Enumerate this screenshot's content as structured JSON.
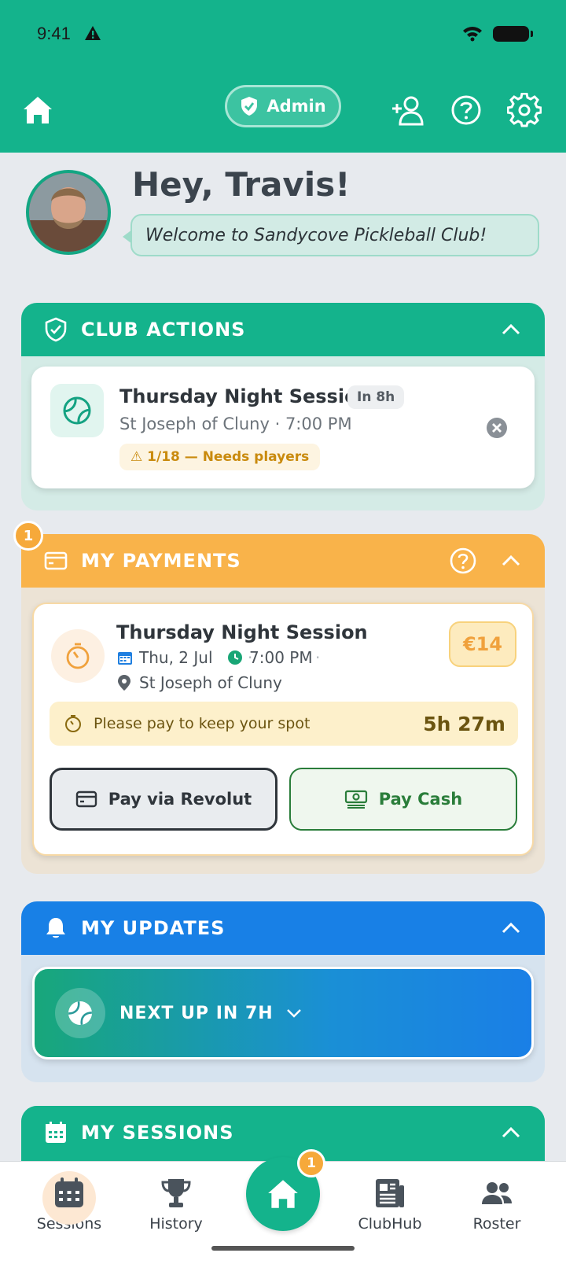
{
  "status": {
    "time": "9:41"
  },
  "header": {
    "admin_label": "Admin"
  },
  "greeting": {
    "title": "Hey, Travis!",
    "welcome": "Welcome to Sandycove Pickleball Club!"
  },
  "club_actions": {
    "title": "CLUB ACTIONS",
    "session_title": "Thursday Night Session",
    "badge": "In 8h",
    "subtitle": "St Joseph of Cluny · 7:00 PM",
    "warning": "⚠ 1/18 — Needs players"
  },
  "payments": {
    "title": "MY PAYMENTS",
    "badge_count": "1",
    "session_title": "Thursday Night Session",
    "date": "Thu, 2 Jul",
    "time": "7:00 PM",
    "venue": "St Joseph of Cluny",
    "price": "€14",
    "notice": "Please pay to keep your spot",
    "countdown": "5h 27m",
    "pay_revolut": "Pay via Revolut",
    "pay_cash": "Pay Cash"
  },
  "updates": {
    "title": "MY UPDATES",
    "next_up": "NEXT UP IN 7H"
  },
  "sessions": {
    "title": "MY SESSIONS"
  },
  "nav": {
    "sessions": "Sessions",
    "history": "History",
    "home_badge": "1",
    "clubhub": "ClubHub",
    "roster": "Roster"
  },
  "colors": {
    "brand_green": "#14b38c",
    "payments_orange": "#f9b34a",
    "updates_blue": "#1880e6",
    "warning_text": "#c98a0d"
  }
}
